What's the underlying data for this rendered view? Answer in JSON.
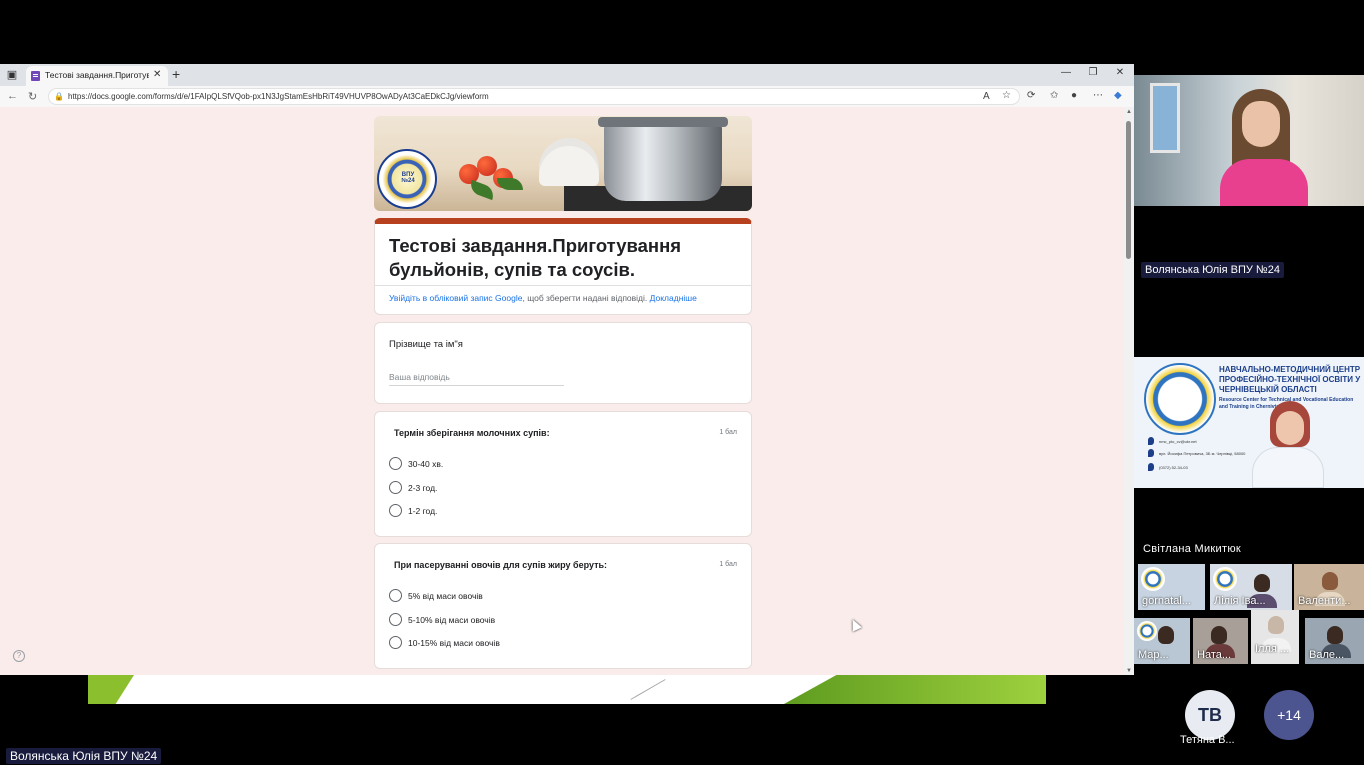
{
  "browser": {
    "tab_title": "Тестові завдання.Приготування",
    "tab_close": "✕",
    "new_tab": "+",
    "url": "https://docs.google.com/forms/d/e/1FAIpQLSfVQob-px1N3JgStamEsHbRiT49VHUVP8OwADyAt3CaEDkCJg/viewform",
    "win_min": "—",
    "win_max": "❐",
    "win_close": "✕"
  },
  "form": {
    "title": "Тестові завдання.Приготування бульйонів, супів та соусів.",
    "signin_link": "Увійдіть в обліковий запис Google",
    "signin_rest": ", щоб зберегти надані відповіді.",
    "learn_more": "Докладніше",
    "banner_logo_text": "ВПУ №24",
    "name_question": "Прізвище та ім\"я",
    "name_placeholder": "Ваша відповідь",
    "questions": [
      {
        "title": "Термін зберігання молочних супів:",
        "points": "1 бал",
        "options": [
          "30-40 хв.",
          "2-3 год.",
          "1-2 год."
        ]
      },
      {
        "title": "При пасеруванні овочів для супів жиру беруть:",
        "points": "1 бал",
        "options": [
          "5% від маси овочів",
          "5-10% від маси овочів",
          "10-15% від маси овочів"
        ]
      }
    ],
    "help_glyph": "?"
  },
  "meeting": {
    "main_speaker": "Волянська Юлія ВПУ №24",
    "center_title": "НАВЧАЛЬНО-МЕТОДИЧНИЙ ЦЕНТР ПРОФЕСІЙНО-ТЕХНІЧНОЇ ОСВІТИ У ЧЕРНІВЕЦЬКІЙ ОБЛАСТІ",
    "center_subtitle": "Resource Center for Technical and Vocational Education and Training in Chernivtsi oblast",
    "center_email": "nmc_ptо_cv@ukr.net",
    "center_address": "вул. Йосифа Петровича, 3Б м. Чернівці, 58000",
    "center_phone": "(0372) 52-34-03",
    "center_speaker": "Світлана  Микитюк",
    "thumbnails": [
      "gornatal...",
      "Лілія Іва...",
      "Валенти...",
      "Мар...",
      "Ната...",
      "Ілля ...",
      "Вале..."
    ],
    "avatar_initials": "ТВ",
    "avatar_label": "Тетяна В...",
    "more_count": "+14",
    "presenter_label": "Волянська Юлія ВПУ №24"
  }
}
